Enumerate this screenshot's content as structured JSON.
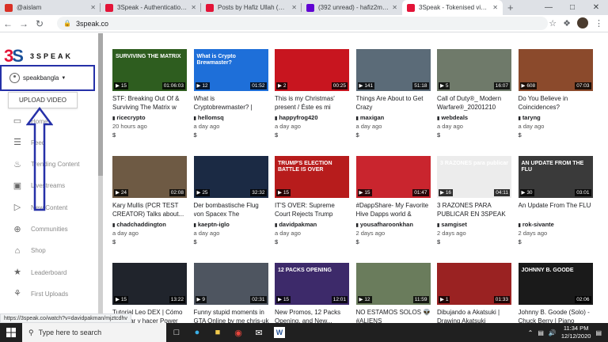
{
  "tabs": [
    {
      "title": "@aislam",
      "fav": "#d93025"
    },
    {
      "title": "3Speak - Authentication Gate",
      "fav": "#e31337"
    },
    {
      "title": "Posts by Hafiz Ullah (@hafizull",
      "fav": "#e31337"
    },
    {
      "title": "(392 unread) - hafiz2metu@ya",
      "fav": "#6001d2"
    },
    {
      "title": "3Speak - Tokenised video co",
      "fav": "#e31337"
    }
  ],
  "url": "3speak.co",
  "sidebar": {
    "logo_mark": "3S",
    "logo_word": "3SPEAK",
    "username": "speakbangla",
    "upload_label": "UPLOAD VIDEO",
    "items": [
      {
        "label": "Home",
        "icon": "monitor-icon"
      },
      {
        "label": "Feed",
        "icon": "feed-icon"
      },
      {
        "label": "Trending Content",
        "icon": "flame-icon"
      },
      {
        "label": "Livestreams",
        "icon": "camera-icon"
      },
      {
        "label": "New Content",
        "icon": "play-icon"
      },
      {
        "label": "Communities",
        "icon": "globe-icon"
      },
      {
        "label": "Shop",
        "icon": "cart-icon"
      },
      {
        "label": "Leaderboard",
        "icon": "trophy-icon"
      },
      {
        "label": "First Uploads",
        "icon": "sprout-icon"
      }
    ]
  },
  "videos": [
    {
      "title": "STF: Breaking Out Of & Surviving The Matrix w M...",
      "author": "ricecrypto",
      "ago": "20 hours ago",
      "pay": "$",
      "views": "15",
      "dur": "01:06:03",
      "bg": "#2e5d1f",
      "overlay": "SURVIVING THE MATRIX"
    },
    {
      "title": "What is Cryptobrewmaster? | Blockchain Card Game | ...",
      "author": "hellomsq",
      "ago": "a day ago",
      "pay": "$",
      "views": "12",
      "dur": "01:52",
      "bg": "#1e6fd9",
      "overlay": "What is Crypto Brewmaster?"
    },
    {
      "title": "This is my Christmas' present / Éste es mi regal...",
      "author": "happyfrog420",
      "ago": "a day ago",
      "pay": "$",
      "views": "2",
      "dur": "00:25",
      "bg": "#c8151f",
      "overlay": ""
    },
    {
      "title": "Things Are About to Get Crazy",
      "author": "maxigan",
      "ago": "a day ago",
      "pay": "$",
      "views": "141",
      "dur": "51:18",
      "bg": "#5b6b78",
      "overlay": ""
    },
    {
      "title": "Call of Duty®_ Modern Warfare®_20201210",
      "author": "webdeals",
      "ago": "a day ago",
      "pay": "$",
      "views": "5",
      "dur": "16:07",
      "bg": "#6f7a6a",
      "overlay": ""
    },
    {
      "title": "Do You Believe in Coincidences?",
      "author": "taryng",
      "ago": "a day ago",
      "pay": "$",
      "views": "608",
      "dur": "07:03",
      "bg": "#8b4a2c",
      "overlay": ""
    },
    {
      "title": "Kary Mullis (PCR TEST CREATOR) Talks about...",
      "author": "chadchaddington",
      "ago": "a day ago",
      "pay": "$",
      "views": "24",
      "dur": "02:08",
      "bg": "#6e5a44",
      "overlay": ""
    },
    {
      "title": "Der bombastische Flug von Spacex The bomastic...",
      "author": "kaeptn-iglo",
      "ago": "a day ago",
      "pay": "$",
      "views": "25",
      "dur": "32:32",
      "bg": "#1b2a44",
      "overlay": ""
    },
    {
      "title": "IT'S OVER: Supreme Court Rejects Trump Challenge i...",
      "author": "davidpakman",
      "ago": "a day ago",
      "pay": "$",
      "views": "15",
      "dur": "",
      "bg": "#b71c1c",
      "overlay": "TRUMP'S ELECTION BATTLE IS OVER"
    },
    {
      "title": "#DappShare- My Favorite Hive Dapps world & Prom...",
      "author": "yousafharoonkhan",
      "ago": "2 days ago",
      "pay": "$",
      "views": "15",
      "dur": "01:47",
      "bg": "#c9252e",
      "overlay": ""
    },
    {
      "title": "3 RAZONES PARA PUBLICAR EN 3SPEAK",
      "author": "samgiset",
      "ago": "2 days ago",
      "pay": "$",
      "views": "16",
      "dur": "04:11",
      "bg": "#ececec",
      "overlay": "3 RAZONES para publicar"
    },
    {
      "title": "An Update From The FLU",
      "author": "rok-sivante",
      "ago": "2 days ago",
      "pay": "$",
      "views": "30",
      "dur": "03:01",
      "bg": "#3a3a3a",
      "overlay": "AN UPDATE FROM THE FLU"
    },
    {
      "title": "Tutorial Leo DEX | Cómo comprar y hacer Power Up...",
      "author": "",
      "ago": "",
      "pay": "",
      "views": "15",
      "dur": "13:22",
      "bg": "#20242c",
      "overlay": ""
    },
    {
      "title": "Funny stupid moments in GTA Online by me chris-uk",
      "author": "",
      "ago": "",
      "pay": "",
      "views": "9",
      "dur": "02:31",
      "bg": "#4e5560",
      "overlay": ""
    },
    {
      "title": "New Promos, 12 Packs Opening, and New...",
      "author": "",
      "ago": "",
      "pay": "",
      "views": "15",
      "dur": "12:01",
      "bg": "#3d2a6a",
      "overlay": "12 PACKS OPENING"
    },
    {
      "title": "NO ESTAMOS SOLOS 👽 #ALIENS",
      "author": "",
      "ago": "",
      "pay": "",
      "views": "12",
      "dur": "11:59",
      "bg": "#6a7c5c",
      "overlay": ""
    },
    {
      "title": "Dibujando a Akatsuki | Drawing Akatsuki",
      "author": "",
      "ago": "",
      "pay": "",
      "views": "1",
      "dur": "01:33",
      "bg": "#9a2222",
      "overlay": ""
    },
    {
      "title": "Johnny B. Goode (Solo) - Chuck Berry | Piano Cover...",
      "author": "",
      "ago": "",
      "pay": "",
      "views": "",
      "dur": "02:06",
      "bg": "#1a1a1a",
      "overlay": "JOHNNY B. GOODE"
    }
  ],
  "status_url": "https://3speak.co/watch?v=davidpakman/mjztcdhv",
  "taskbar": {
    "search": "Type here to search",
    "time": "11:34 PM",
    "date": "12/12/2020"
  }
}
